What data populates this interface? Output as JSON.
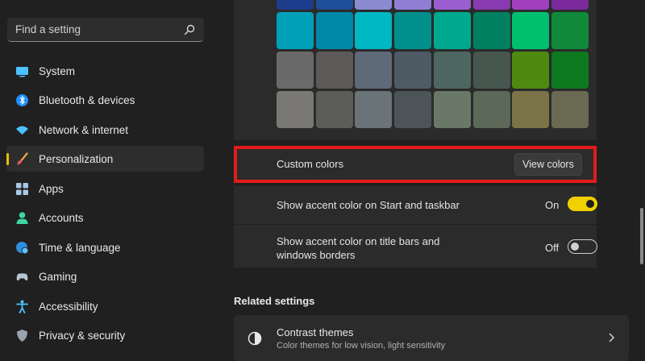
{
  "search": {
    "placeholder": "Find a setting"
  },
  "sidebar": {
    "items": [
      {
        "label": "System",
        "icon": "monitor-icon"
      },
      {
        "label": "Bluetooth & devices",
        "icon": "bluetooth-icon"
      },
      {
        "label": "Network & internet",
        "icon": "wifi-icon"
      },
      {
        "label": "Personalization",
        "icon": "brush-icon",
        "active": true
      },
      {
        "label": "Apps",
        "icon": "apps-icon"
      },
      {
        "label": "Accounts",
        "icon": "person-icon"
      },
      {
        "label": "Time & language",
        "icon": "globe-clock-icon"
      },
      {
        "label": "Gaming",
        "icon": "controller-icon"
      },
      {
        "label": "Accessibility",
        "icon": "accessibility-icon"
      },
      {
        "label": "Privacy & security",
        "icon": "shield-icon"
      }
    ]
  },
  "colors": {
    "accent": "#f0d000",
    "highlight_border": "#e21b1b",
    "swatch_rows": [
      [
        "#1e3c8c",
        "#1e4f9a",
        "#8a8ad0",
        "#8f7fd4",
        "#9a5ed0",
        "#8a3ab0",
        "#a040c0",
        "#7a2a9a"
      ],
      [
        "#00a0b8",
        "#0088a8",
        "#00b8c4",
        "#008f8a",
        "#00a890",
        "#008060",
        "#00c070",
        "#108a3a"
      ],
      [
        "#6a6a6a",
        "#5c5a58",
        "#5e6a78",
        "#4e5a64",
        "#4e6660",
        "#485650",
        "#4e8a10",
        "#0e7a20"
      ],
      [
        "#7a7874",
        "#5c5c58",
        "#6a7478",
        "#4c5458",
        "#6a7868",
        "#5c6858",
        "#7a7448",
        "#6a6a52"
      ]
    ]
  },
  "custom_colors": {
    "label": "Custom colors",
    "button": "View colors"
  },
  "accent_start": {
    "label": "Show accent color on Start and taskbar",
    "state": "On"
  },
  "accent_titlebars": {
    "label_line1": "Show accent color on title bars and",
    "label_line2": "windows borders",
    "state": "Off"
  },
  "related": {
    "heading": "Related settings",
    "contrast_title": "Contrast themes",
    "contrast_subtitle": "Color themes for low vision, light sensitivity"
  }
}
